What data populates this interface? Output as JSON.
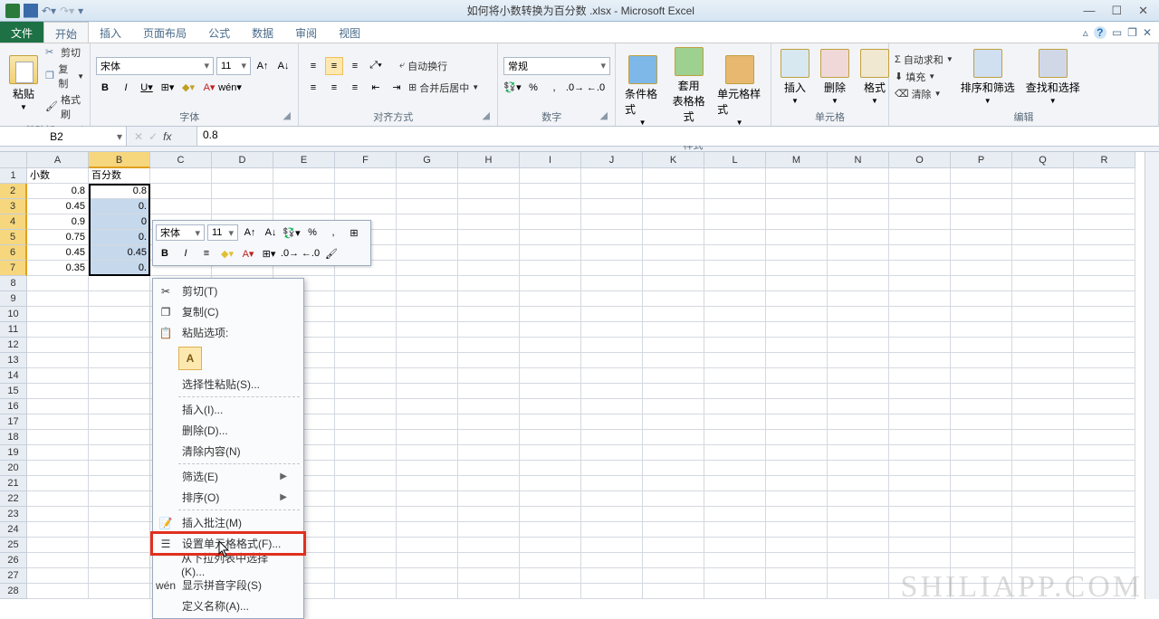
{
  "title": "如何将小数转换为百分数 .xlsx - Microsoft Excel",
  "tabs": {
    "file": "文件",
    "home": "开始",
    "insert": "插入",
    "layout": "页面布局",
    "formula": "公式",
    "data": "数据",
    "review": "审阅",
    "view": "视图"
  },
  "clipboard": {
    "paste": "粘贴",
    "cut": "剪切",
    "copy": "复制",
    "format_painter": "格式刷",
    "group": "剪贴板"
  },
  "font": {
    "name": "宋体",
    "size": "11",
    "group": "字体"
  },
  "align": {
    "wrap": "自动换行",
    "merge": "合并后居中",
    "group": "对齐方式"
  },
  "number": {
    "format": "常规",
    "group": "数字"
  },
  "styles": {
    "cond": "条件格式",
    "table": "套用\n表格格式",
    "cell": "单元格样式",
    "group": "样式"
  },
  "cells": {
    "insert": "插入",
    "delete": "删除",
    "format": "格式",
    "group": "单元格"
  },
  "editing": {
    "autosum": "自动求和",
    "fill": "填充",
    "clear": "清除",
    "sort": "排序和筛选",
    "find": "查找和选择",
    "group": "编辑"
  },
  "namebox": "B2",
  "formula": "0.8",
  "columns": [
    "A",
    "B",
    "C",
    "D",
    "E",
    "F",
    "G",
    "H",
    "I",
    "J",
    "K",
    "L",
    "M",
    "N",
    "O",
    "P",
    "Q",
    "R"
  ],
  "rows": [
    "1",
    "2",
    "3",
    "4",
    "5",
    "6",
    "7",
    "8",
    "9",
    "10",
    "11",
    "12",
    "13",
    "14",
    "15",
    "16",
    "17",
    "18",
    "19",
    "20",
    "21",
    "22",
    "23",
    "24",
    "25",
    "26",
    "27",
    "28"
  ],
  "data": {
    "A1": "小数",
    "B1": "百分数",
    "A2": "0.8",
    "B2": "0.8",
    "A3": "0.45",
    "B3": "0.",
    "A4": "0.9",
    "B4": "0",
    "A5": "0.75",
    "B5": "0.",
    "A6": "0.45",
    "B6": "0.45",
    "A7": "0.35",
    "B7": "0."
  },
  "mini": {
    "font": "宋体",
    "size": "11"
  },
  "ctx": {
    "cut": "剪切(T)",
    "copy": "复制(C)",
    "paste_opts": "粘贴选项:",
    "paste_special": "选择性粘贴(S)...",
    "insert": "插入(I)...",
    "delete": "删除(D)...",
    "clear": "清除内容(N)",
    "filter": "筛选(E)",
    "sort": "排序(O)",
    "comment": "插入批注(M)",
    "format_cells": "设置单元格格式(F)...",
    "dropdown": "从下拉列表中选择(K)...",
    "phonetic": "显示拼音字段(S)",
    "define_name": "定义名称(A)..."
  },
  "watermark": "SHILIAPP.COM"
}
